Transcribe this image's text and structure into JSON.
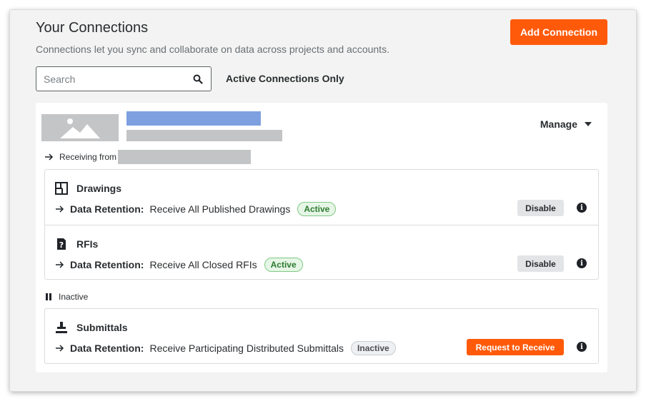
{
  "header": {
    "title": "Your Connections",
    "subtitle": "Connections let you sync and collaborate on data across projects and accounts.",
    "add_button": "Add Connection"
  },
  "search": {
    "placeholder": "Search",
    "value": ""
  },
  "filter": {
    "label": "Active Connections Only"
  },
  "connection": {
    "manage_label": "Manage",
    "receiving_label": "Receiving from",
    "active_items": [
      {
        "icon": "drawings-icon",
        "title": "Drawings",
        "retention_label": "Data Retention:",
        "retention_value": "Receive All Published Drawings",
        "status": "Active",
        "action": "Disable"
      },
      {
        "icon": "rfi-icon",
        "title": "RFIs",
        "retention_label": "Data Retention:",
        "retention_value": "Receive All Closed RFIs",
        "status": "Active",
        "action": "Disable"
      }
    ],
    "inactive_label": "Inactive",
    "inactive_items": [
      {
        "icon": "submittals-icon",
        "title": "Submittals",
        "retention_label": "Data Retention:",
        "retention_value": "Receive Participating Distributed Submittals",
        "status": "Inactive",
        "action": "Request to Receive"
      }
    ]
  },
  "colors": {
    "accent": "#ff5a0a",
    "active_badge": "#2d7a30",
    "placeholder_blue": "#7ea0e0",
    "placeholder_gray": "#c3c4c5"
  }
}
